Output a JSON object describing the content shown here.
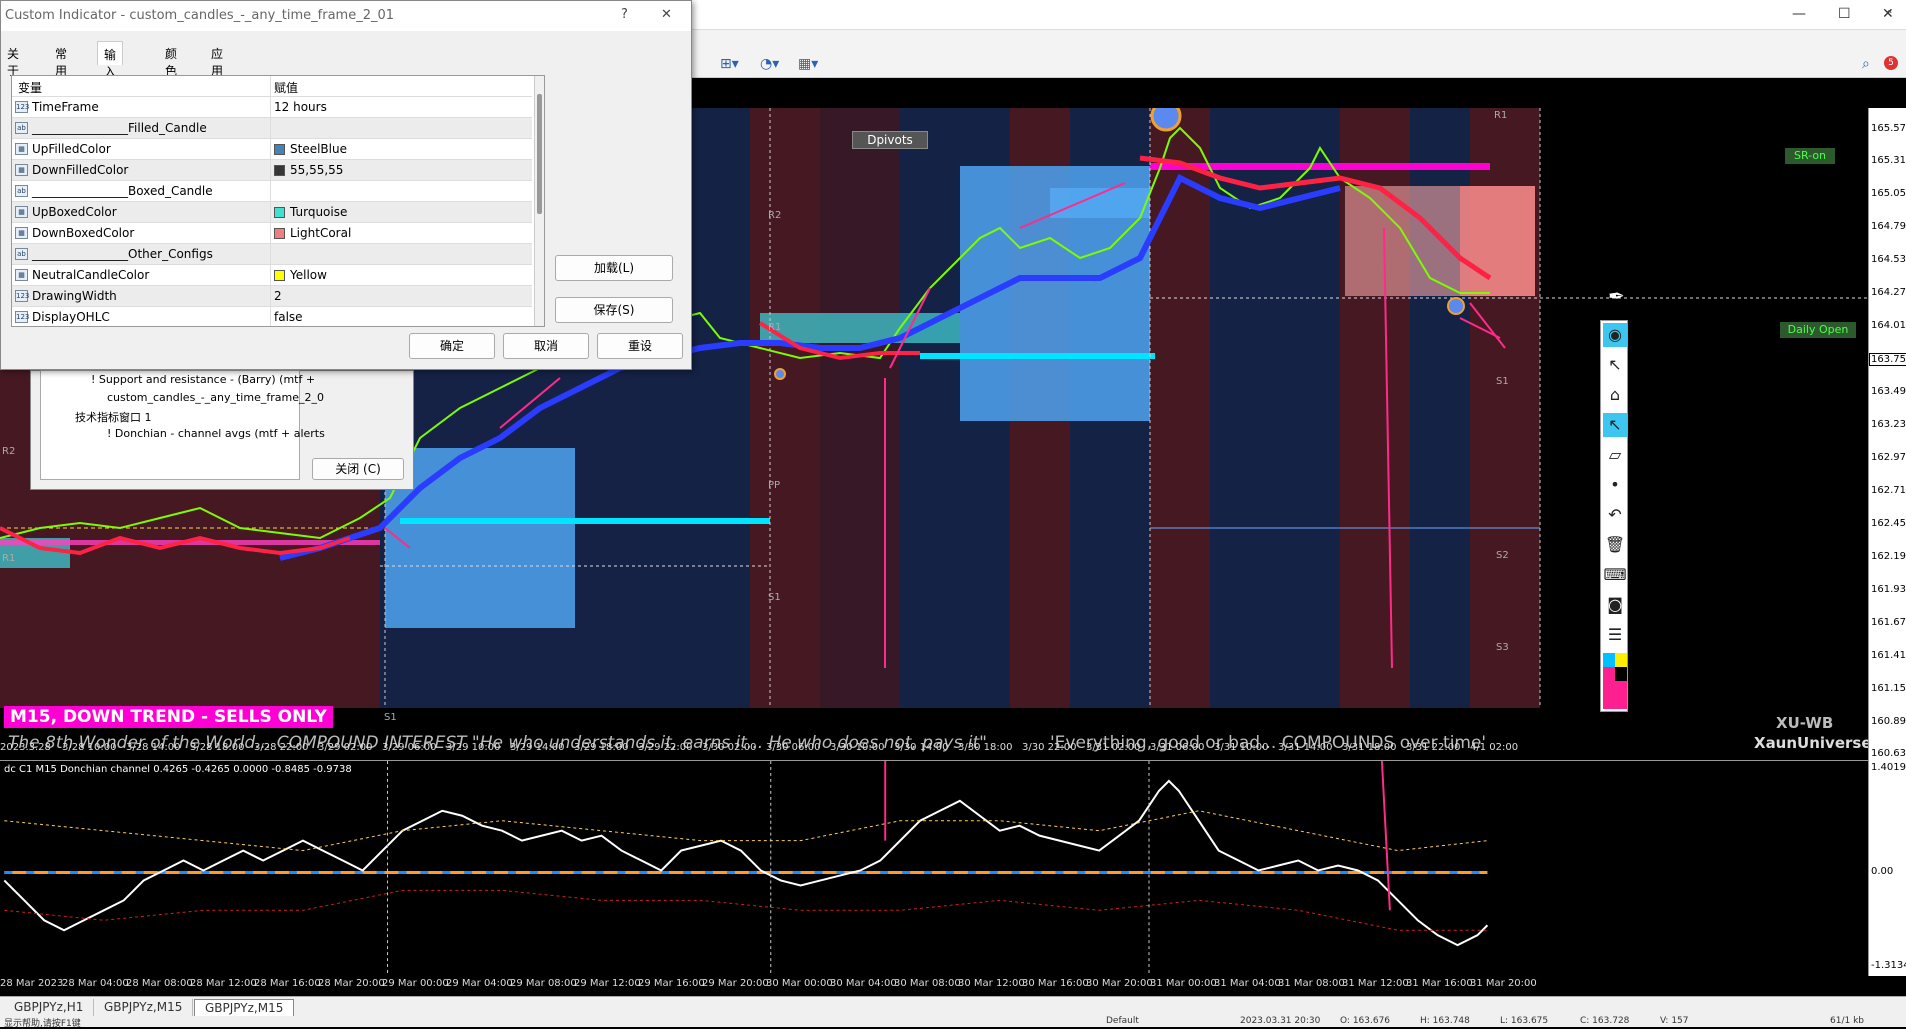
{
  "window": {
    "minimize": "—",
    "maximize": "☐",
    "close": "✕"
  },
  "dialog": {
    "title": "Custom Indicator - custom_candles_-_any_time_frame_2_01",
    "help": "?",
    "close": "✕",
    "tabs": [
      "关于",
      "常用",
      "输入参数",
      "颜色",
      "应用范围"
    ],
    "active_tab": 2,
    "grid_headers": {
      "variable": "变量",
      "value": "赋值"
    },
    "params": [
      {
        "icon": "123",
        "name": "TimeFrame",
        "value": "12 hours",
        "swatch": ""
      },
      {
        "icon": "ab",
        "name": "________________Filled_Candle",
        "value": "",
        "swatch": ""
      },
      {
        "icon": "clr",
        "name": "UpFilledColor",
        "value": "SteelBlue",
        "swatch": "#4682b4"
      },
      {
        "icon": "clr",
        "name": "DownFilledColor",
        "value": "55,55,55",
        "swatch": "#373737"
      },
      {
        "icon": "ab",
        "name": "________________Boxed_Candle",
        "value": "",
        "swatch": ""
      },
      {
        "icon": "clr",
        "name": "UpBoxedColor",
        "value": "Turquoise",
        "swatch": "#40e0d0"
      },
      {
        "icon": "clr",
        "name": "DownBoxedColor",
        "value": "LightCoral",
        "swatch": "#f08080"
      },
      {
        "icon": "ab",
        "name": "________________Other_Configs",
        "value": "",
        "swatch": ""
      },
      {
        "icon": "clr",
        "name": "NeutralCandleColor",
        "value": "Yellow",
        "swatch": "#ffff00"
      },
      {
        "icon": "123",
        "name": "DrawingWidth",
        "value": "2",
        "swatch": ""
      },
      {
        "icon": "123",
        "name": "DisplayOHLC",
        "value": "false",
        "swatch": ""
      }
    ],
    "load_button": "加载(L)",
    "save_button": "保存(S)",
    "ok_button": "确定",
    "cancel_button": "取消",
    "reset_button": "重设"
  },
  "object_list": {
    "items": [
      "! Support and resistance - (Barry) (mtf +",
      "custom_candles_-_any_time_frame_2_0",
      "技术指标窗口 1",
      "! Donchian - channel avgs (mtf + alerts"
    ],
    "close_button": "关闭 (C)"
  },
  "chart": {
    "dpivots_label": "Dpivots",
    "sr_label": "SR-on",
    "daily_open_label": "Daily Open",
    "trend_banner": "M15, DOWN TREND - SELLS ONLY",
    "quote_left": "The 8th Wonder of the World... COMPOUND INTEREST \"He who understands it, earns it... He who does not, pays it\"",
    "quote_right": "'Everything, good or bad... COMPOUNDS over time'",
    "brand_1": "XU-WB",
    "brand_2": "XaunUniverse",
    "pivot_labels": [
      "R1",
      "R2",
      "R1",
      "S1",
      "S1",
      "S2",
      "S3",
      "R2",
      "R1",
      "PP",
      "S1"
    ],
    "current_price": "163.757",
    "price_ticks": [
      "165.570",
      "165.310",
      "165.050",
      "164.790",
      "164.530",
      "164.270",
      "164.010",
      "163.750",
      "163.490",
      "163.230",
      "162.970",
      "162.710",
      "162.450",
      "162.190",
      "161.930",
      "161.670",
      "161.410",
      "161.150",
      "160.890",
      "160.630"
    ],
    "time_ticks": [
      "2023.3.28",
      "3/28 10:00",
      "3/28 14:00",
      "3/28 18:00",
      "3/28 22:00",
      "3/29 02:00",
      "3/29 06:00",
      "3/29 10:00",
      "3/29 14:00",
      "3/29 18:00",
      "3/29 22:00",
      "3/30 02:00",
      "3/30 06:00",
      "3/30 10:00",
      "3/30 14:00",
      "3/30 18:00",
      "3/30 22:00",
      "3/31 02:00",
      "3/31 06:00",
      "3/31 10:00",
      "3/31 14:00",
      "3/31 18:00",
      "3/31 22:00",
      "4/1 02:00"
    ]
  },
  "oscillator": {
    "title": "dc C1 M15 Donchian channel 0.4265 -0.4265 0.0000 -0.8485 -0.9738",
    "axis_ticks": [
      "1.4019",
      "0.00",
      "-1.3134"
    ],
    "time_ticks": [
      "28 Mar 2023",
      "28 Mar 04:00",
      "28 Mar 08:00",
      "28 Mar 12:00",
      "28 Mar 16:00",
      "28 Mar 20:00",
      "29 Mar 00:00",
      "29 Mar 04:00",
      "29 Mar 08:00",
      "29 Mar 12:00",
      "29 Mar 16:00",
      "29 Mar 20:00",
      "30 Mar 00:00",
      "30 Mar 04:00",
      "30 Mar 08:00",
      "30 Mar 12:00",
      "30 Mar 16:00",
      "30 Mar 20:00",
      "31 Mar 00:00",
      "31 Mar 04:00",
      "31 Mar 08:00",
      "31 Mar 12:00",
      "31 Mar 16:00",
      "31 Mar 20:00"
    ]
  },
  "tabs": [
    "GBPJPYz,H1",
    "GBPJPYz,M15",
    "GBPJPYz,M15"
  ],
  "active_tab": 2,
  "statusbar": {
    "left": "显示帮助,请按F1键",
    "profile": "Default",
    "datetime": "2023.03.31 20:30",
    "o": "O: 163.676",
    "h": "H: 163.748",
    "l": "L: 163.675",
    "c": "C: 163.728",
    "v": "V: 157",
    "traffic": "61/1 kb"
  }
}
